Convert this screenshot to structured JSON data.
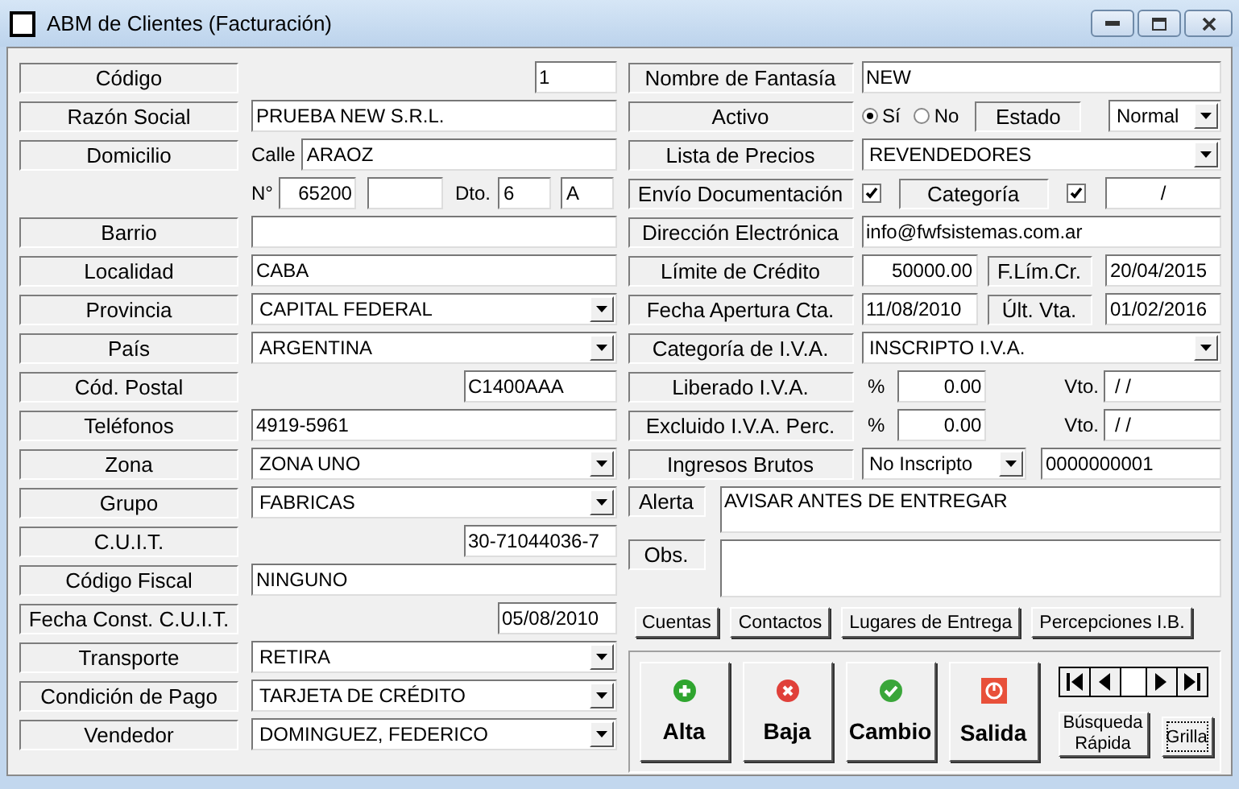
{
  "window": {
    "title": "ABM de Clientes (Facturación)"
  },
  "left_rows": [
    {
      "kind": "tiny",
      "label": "Código",
      "value": "1"
    },
    {
      "kind": "text",
      "label": "Razón Social",
      "value": "PRUEBA NEW S.R.L."
    },
    {
      "kind": "street",
      "label": "Domicilio",
      "prefix": "Calle",
      "value": "ARAOZ"
    },
    {
      "kind": "number",
      "prefix": "N°",
      "value": "65200",
      "dto_label": "Dto.",
      "dto": "6",
      "unit": "A"
    },
    {
      "kind": "text",
      "label": "Barrio"
    },
    {
      "kind": "text",
      "label": "Localidad",
      "value": "CABA"
    },
    {
      "kind": "combo",
      "label": "Provincia",
      "value": "CAPITAL FEDERAL"
    },
    {
      "kind": "combo",
      "label": "País",
      "value": "ARGENTINA"
    },
    {
      "kind": "short",
      "label": "Cód. Postal",
      "value": "C1400AAA"
    },
    {
      "kind": "text",
      "label": "Teléfonos",
      "value": "4919-5961"
    },
    {
      "kind": "combo",
      "label": "Zona",
      "value": "ZONA UNO"
    },
    {
      "kind": "combo",
      "label": "Grupo",
      "value": "FABRICAS"
    },
    {
      "kind": "short",
      "label": "C.U.I.T.",
      "value": "30-71044036-7"
    },
    {
      "kind": "text",
      "label": "Código Fiscal",
      "value": "NINGUNO"
    },
    {
      "kind": "date",
      "label": "Fecha Const. C.U.I.T.",
      "value": "05/08/2010"
    },
    {
      "kind": "combo",
      "label": "Transporte",
      "value": "RETIRA"
    },
    {
      "kind": "combo",
      "label": "Condición de Pago",
      "value": "TARJETA DE CRÉDITO"
    },
    {
      "kind": "combo",
      "label": "Vendedor",
      "value": "DOMINGUEZ, FEDERICO"
    }
  ],
  "right_rows": [
    {
      "kind": "text",
      "label": "Nombre de Fantasía",
      "value": "NEW"
    },
    {
      "kind": "radio",
      "label": "Activo",
      "options": [
        {
          "label": "Sí",
          "selected": true
        },
        {
          "label": "No",
          "selected": false
        }
      ],
      "estado_label": "Estado",
      "estado": "Normal"
    },
    {
      "kind": "combo",
      "label": "Lista de Precios",
      "value": "REVENDEDORES"
    },
    {
      "kind": "checks",
      "label": "Envío Documentación",
      "checked": true,
      "categoria_label": "Categoría",
      "categoria_checked": true,
      "categoria_value": "/"
    },
    {
      "kind": "text",
      "label": "Dirección Electrónica",
      "value": "info@fwfsistemas.com.ar"
    },
    {
      "kind": "amount_pair",
      "label": "Límite de Crédito",
      "value": "50000.00",
      "label2": "F.Lím.Cr.",
      "value2": "20/04/2015"
    },
    {
      "kind": "date_pair",
      "label": "Fecha Apertura Cta.",
      "value": "11/08/2010",
      "label2": "Últ. Vta.",
      "value2": "01/02/2016"
    },
    {
      "kind": "combo",
      "label": "Categoría de I.V.A.",
      "value": "INSCRIPTO I.V.A."
    },
    {
      "kind": "percent",
      "label": "Liberado I.V.A.",
      "symbol": "%",
      "value": "0.00",
      "label2": "Vto.",
      "value2": "/ /"
    },
    {
      "kind": "percent",
      "label": "Excluido I.V.A. Perc.",
      "symbol": "%",
      "value": "0.00",
      "label2": "Vto.",
      "value2": "/ /"
    },
    {
      "kind": "ingresos",
      "label": "Ingresos Brutos",
      "value": "No Inscripto",
      "number": "0000000001"
    }
  ],
  "alerta": {
    "label": "Alerta",
    "value": "AVISAR ANTES DE ENTREGAR"
  },
  "obs": {
    "label": "Obs."
  },
  "tab_buttons": [
    "Cuentas",
    "Contactos",
    "Lugares de Entrega",
    "Percepciones I.B."
  ],
  "actions": [
    {
      "kind": "add",
      "label": "Alta"
    },
    {
      "kind": "delete",
      "label": "Baja"
    },
    {
      "kind": "confirm",
      "label": "Cambio"
    },
    {
      "kind": "exit",
      "label": "Salida"
    }
  ],
  "search_button": "Búsqueda Rápida",
  "grid_button": "Grilla"
}
